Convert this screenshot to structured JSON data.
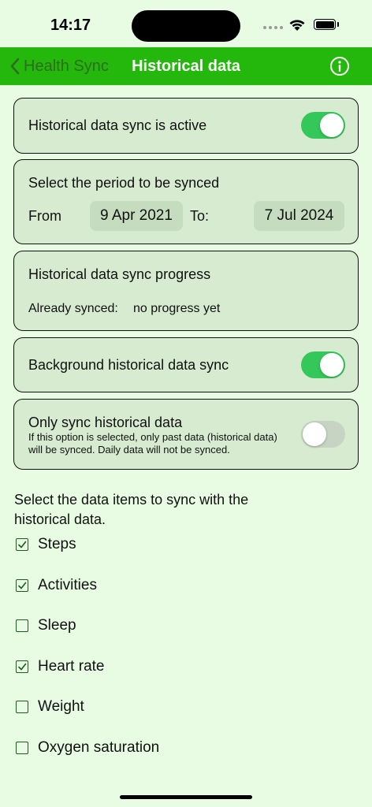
{
  "status_bar": {
    "time": "14:17"
  },
  "nav": {
    "back_label": "Health Sync",
    "title": "Historical data"
  },
  "sync_active": {
    "label": "Historical data sync is active",
    "enabled": true
  },
  "period": {
    "title": "Select the period to be synced",
    "from_label": "From",
    "from_value": "9 Apr 2021",
    "to_label": "To:",
    "to_value": "7 Jul 2024"
  },
  "progress": {
    "title": "Historical data sync progress",
    "already_label": "Already synced:",
    "already_value": "no progress yet"
  },
  "background_sync": {
    "label": "Background historical data sync",
    "enabled": true
  },
  "only_historical": {
    "label": "Only sync historical data",
    "description": "If this option is selected, only past data (historical data) will be synced. Daily data will not be synced.",
    "enabled": false
  },
  "data_items": {
    "intro": "Select the data items to sync with the historical data.",
    "items": [
      {
        "label": "Steps",
        "checked": true
      },
      {
        "label": "Activities",
        "checked": true
      },
      {
        "label": "Sleep",
        "checked": false
      },
      {
        "label": "Heart rate",
        "checked": true
      },
      {
        "label": "Weight",
        "checked": false
      },
      {
        "label": "Oxygen saturation",
        "checked": false
      }
    ]
  },
  "colors": {
    "nav_green": "#25b80c",
    "toggle_on": "#34c759",
    "background": "#e8fce4",
    "card": "#d6ebd0"
  }
}
